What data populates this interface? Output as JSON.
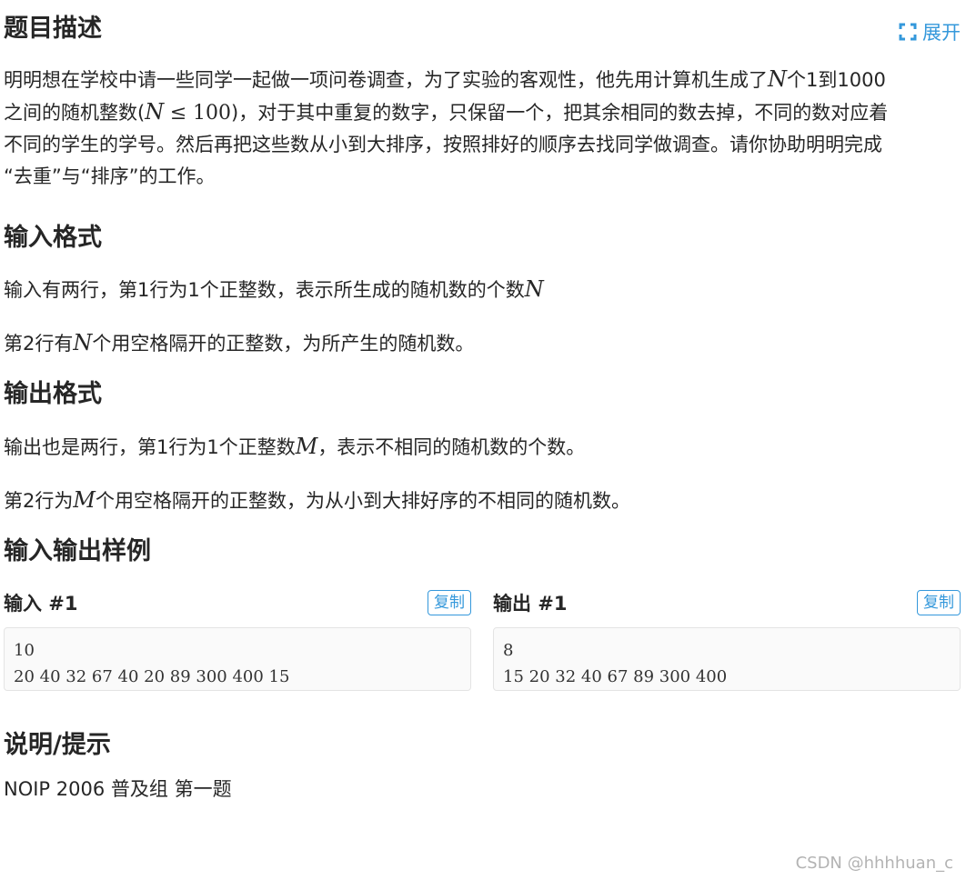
{
  "description": {
    "title": "题目描述",
    "expand_label": "展开",
    "line1_a": "明明想在学校中请一些同学一起做一项问卷调查，为了实验的客观性，他先用计算机生成了",
    "var_N": "N",
    "line1_b": "个1到1000",
    "line2_a": "之间的随机整数(",
    "le": "≤",
    "hundred": "100",
    "line2_b": ")，对于其中重复的数字，只保留一个，把其余相同的数去掉，不同的数对应着",
    "line3": "不同的学生的学号。然后再把这些数从小到大排序，按照排好的顺序去找同学做调查。请你协助明明完成",
    "line4": "“去重”与“排序”的工作。"
  },
  "input_format": {
    "title": "输入格式",
    "line1": "输入有两行，第1行为1个正整数，表示所生成的随机数的个数",
    "line2_a": "第2行有",
    "line2_b": "个用空格隔开的正整数，为所产生的随机数。"
  },
  "output_format": {
    "title": "输出格式",
    "var_M": "M",
    "line1_a": "输出也是两行，第1行为1个正整数",
    "line1_b": "，表示不相同的随机数的个数。",
    "line2_a": "第2行为",
    "line2_b": "个用空格隔开的正整数，为从小到大排好序的不相同的随机数。"
  },
  "samples": {
    "title": "输入输出样例",
    "copy_label": "复制",
    "input_title": "输入 #1",
    "input_lines": [
      "10",
      "20 40 32 67 40 20 89 300 400 15"
    ],
    "output_title": "输出 #1",
    "output_lines": [
      "8",
      "15 20 32 40 67 89 300 400"
    ]
  },
  "hint": {
    "title": "说明/提示",
    "text": "NOIP 2006 普及组 第一题"
  },
  "watermark": "CSDN @hhhhuan_c",
  "colors": {
    "accent": "#3498db",
    "text": "#262626"
  }
}
